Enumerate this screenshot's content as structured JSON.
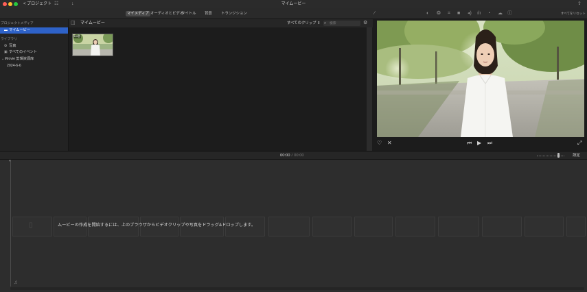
{
  "window": {
    "title": "マイムービー",
    "back_label": "< プロジェクト"
  },
  "toolbar": {
    "tabs": [
      "マイメディア",
      "オーディオとビデオ",
      "タイトル",
      "背景",
      "トランジション"
    ],
    "active_tab": "マイメディア",
    "adjust_icons": [
      "magic-wand-icon",
      "color-balance-icon",
      "color-correction-icon",
      "crop-icon",
      "stabilization-icon",
      "volume-icon",
      "equalizer-icon",
      "speed-icon",
      "filter-icon",
      "info-icon"
    ],
    "reset_all_label": "すべてをリセット"
  },
  "sidebar": {
    "project_media_heading": "プロジェクトメディア",
    "selected_item": "マイムービー",
    "library_heading": "ライブラリ",
    "items": [
      {
        "label": "写真",
        "icon": "photos-icon"
      },
      {
        "label": "すべてのイベント",
        "icon": "events-icon"
      }
    ],
    "library_name": "iMovie 剪辑资源库",
    "event_name": "2024-6-6"
  },
  "browser": {
    "title": "マイムービー",
    "filter_label": "すべてのクリップ",
    "search_placeholder": "検索",
    "clip_duration": "6.0秒"
  },
  "viewer": {
    "controls": [
      "favorite-icon",
      "reject-icon",
      "skip-back-icon",
      "play-icon",
      "skip-forward-icon",
      "fullscreen-icon"
    ]
  },
  "timeline": {
    "current_time": "00:00",
    "separator": "/",
    "total_time": "00:00",
    "settings_label": "設定",
    "empty_hint": "ムービーの作成を開始するには、上のブラウザからビデオクリップや写真をドラッグ&ドロップします。"
  },
  "colors": {
    "selection": "#2e62c8",
    "window_bg": "#1e1e1e",
    "timeline_bg": "#2d2d2d"
  }
}
